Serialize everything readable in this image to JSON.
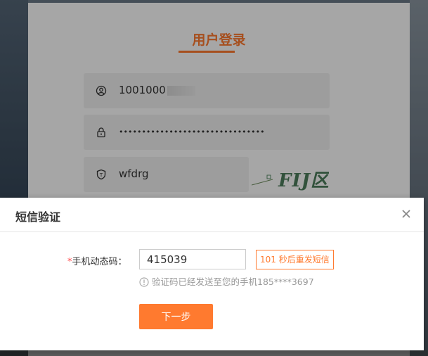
{
  "login": {
    "title": "用户登录",
    "username_visible": "1001000",
    "password_mask": "••••••••••••••••••••••••••••••••",
    "captcha_value": "wfdrg",
    "captcha_text": "FIJ区"
  },
  "dialog": {
    "title": "短信验证",
    "required_mark": "*",
    "code_label": "手机动态码：",
    "code_value": "415039",
    "resend_label": "101 秒后重发短信",
    "hint_text": "验证码已经发送至您的手机185****3697",
    "next_label": "下一步"
  },
  "colors": {
    "accent": "#ff7a2f",
    "hint": "#999999"
  },
  "icons": {
    "user": "user-icon",
    "lock": "lock-icon",
    "shield": "shield-icon",
    "close": "close-icon",
    "info": "info-icon"
  }
}
